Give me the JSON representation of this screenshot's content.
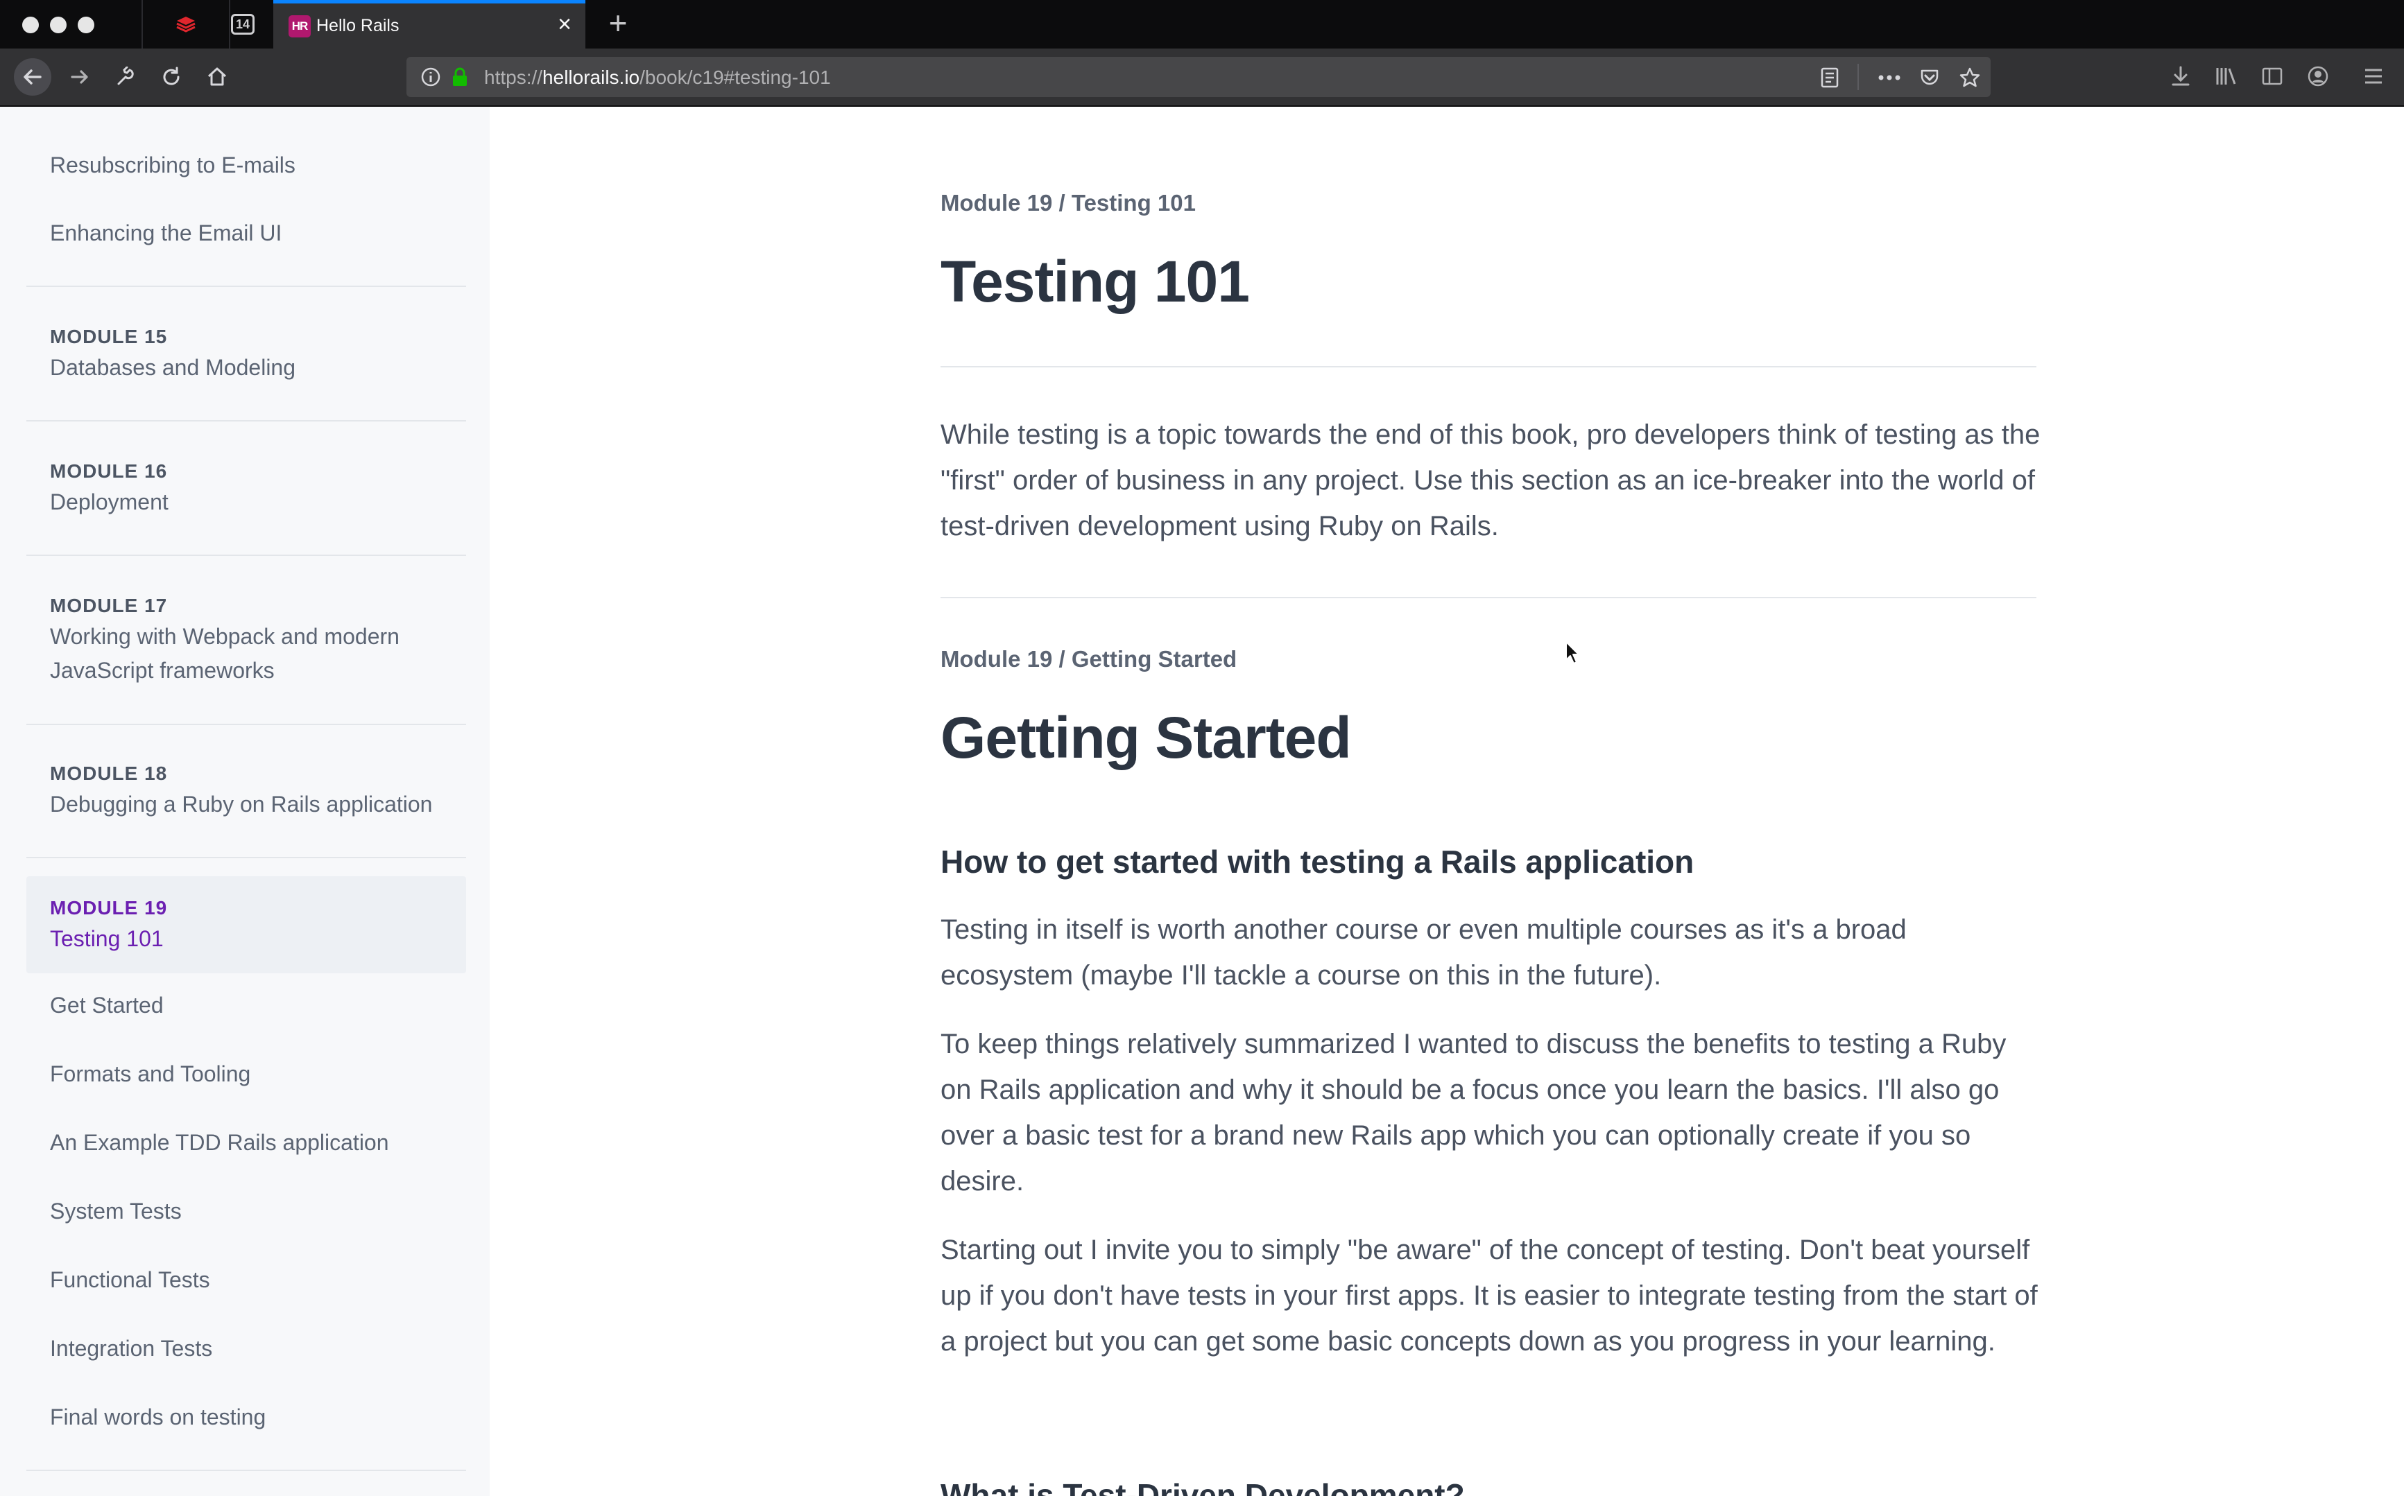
{
  "browser": {
    "tab_title": "Hello Rails",
    "favicon_text": "HR",
    "pinned_tab_2_text": "14",
    "url_prefix": "https://",
    "url_host": "hellorails.io",
    "url_path": "/book/c19#testing-101",
    "colors": {
      "chrome_dark": "#0c0c0d",
      "toolbar": "#323234",
      "accent": "#0a84ff",
      "favicon": "#b0186e"
    },
    "icons": [
      "back-icon",
      "forward-icon",
      "wrench-icon",
      "reload-icon",
      "home-icon",
      "info-icon",
      "lock-icon",
      "reader-view-icon",
      "more-icon",
      "pocket-icon",
      "bookmark-star-icon",
      "download-icon",
      "library-icon",
      "sidebar-icon",
      "account-icon",
      "menu-icon"
    ]
  },
  "sidebar": {
    "links_top": [
      "Resubscribing to E-mails",
      "Enhancing the Email UI"
    ],
    "modules": [
      {
        "label": "MODULE 15",
        "title": "Databases and Modeling"
      },
      {
        "label": "MODULE 16",
        "title": "Deployment"
      },
      {
        "label": "MODULE 17",
        "title": "Working with Webpack and modern JavaScript frameworks"
      },
      {
        "label": "MODULE 18",
        "title": "Debugging a Ruby on Rails application"
      },
      {
        "label": "MODULE 19",
        "title": "Testing 101"
      }
    ],
    "sub_links": [
      "Get Started",
      "Formats and Tooling",
      "An Example TDD Rails application",
      "System Tests",
      "Functional Tests",
      "Integration Tests",
      "Final words on testing"
    ],
    "active_color": "#6b1fb1"
  },
  "content": {
    "section1": {
      "breadcrumb": "Module 19 / Testing 101",
      "title": "Testing 101",
      "intro": "While testing is a topic towards the end of this book, pro developers think of testing as the \"first\" order of business in any project. Use this section as an ice-breaker into the world of test-driven development using Ruby on Rails."
    },
    "section2": {
      "breadcrumb": "Module 19 / Getting Started",
      "title": "Getting Started",
      "subheading": "How to get started with testing a Rails application",
      "paragraphs": [
        "Testing in itself is worth another course or even multiple courses as it's a broad ecosystem (maybe I'll tackle a course on this in the future).",
        "To keep things relatively summarized I wanted to discuss the benefits to testing a Ruby on Rails application and why it should be a focus once you learn the basics. I'll also go over a basic test for a brand new Rails app which you can optionally create if you so desire.",
        "Starting out I invite you to simply \"be aware\" of the concept of testing. Don't beat yourself up if you don't have tests in your first apps. It is easier to integrate testing from the start of a project but you can get some basic concepts down as you progress in your learning."
      ],
      "next_heading": "What is Test-Driven Development?"
    }
  }
}
